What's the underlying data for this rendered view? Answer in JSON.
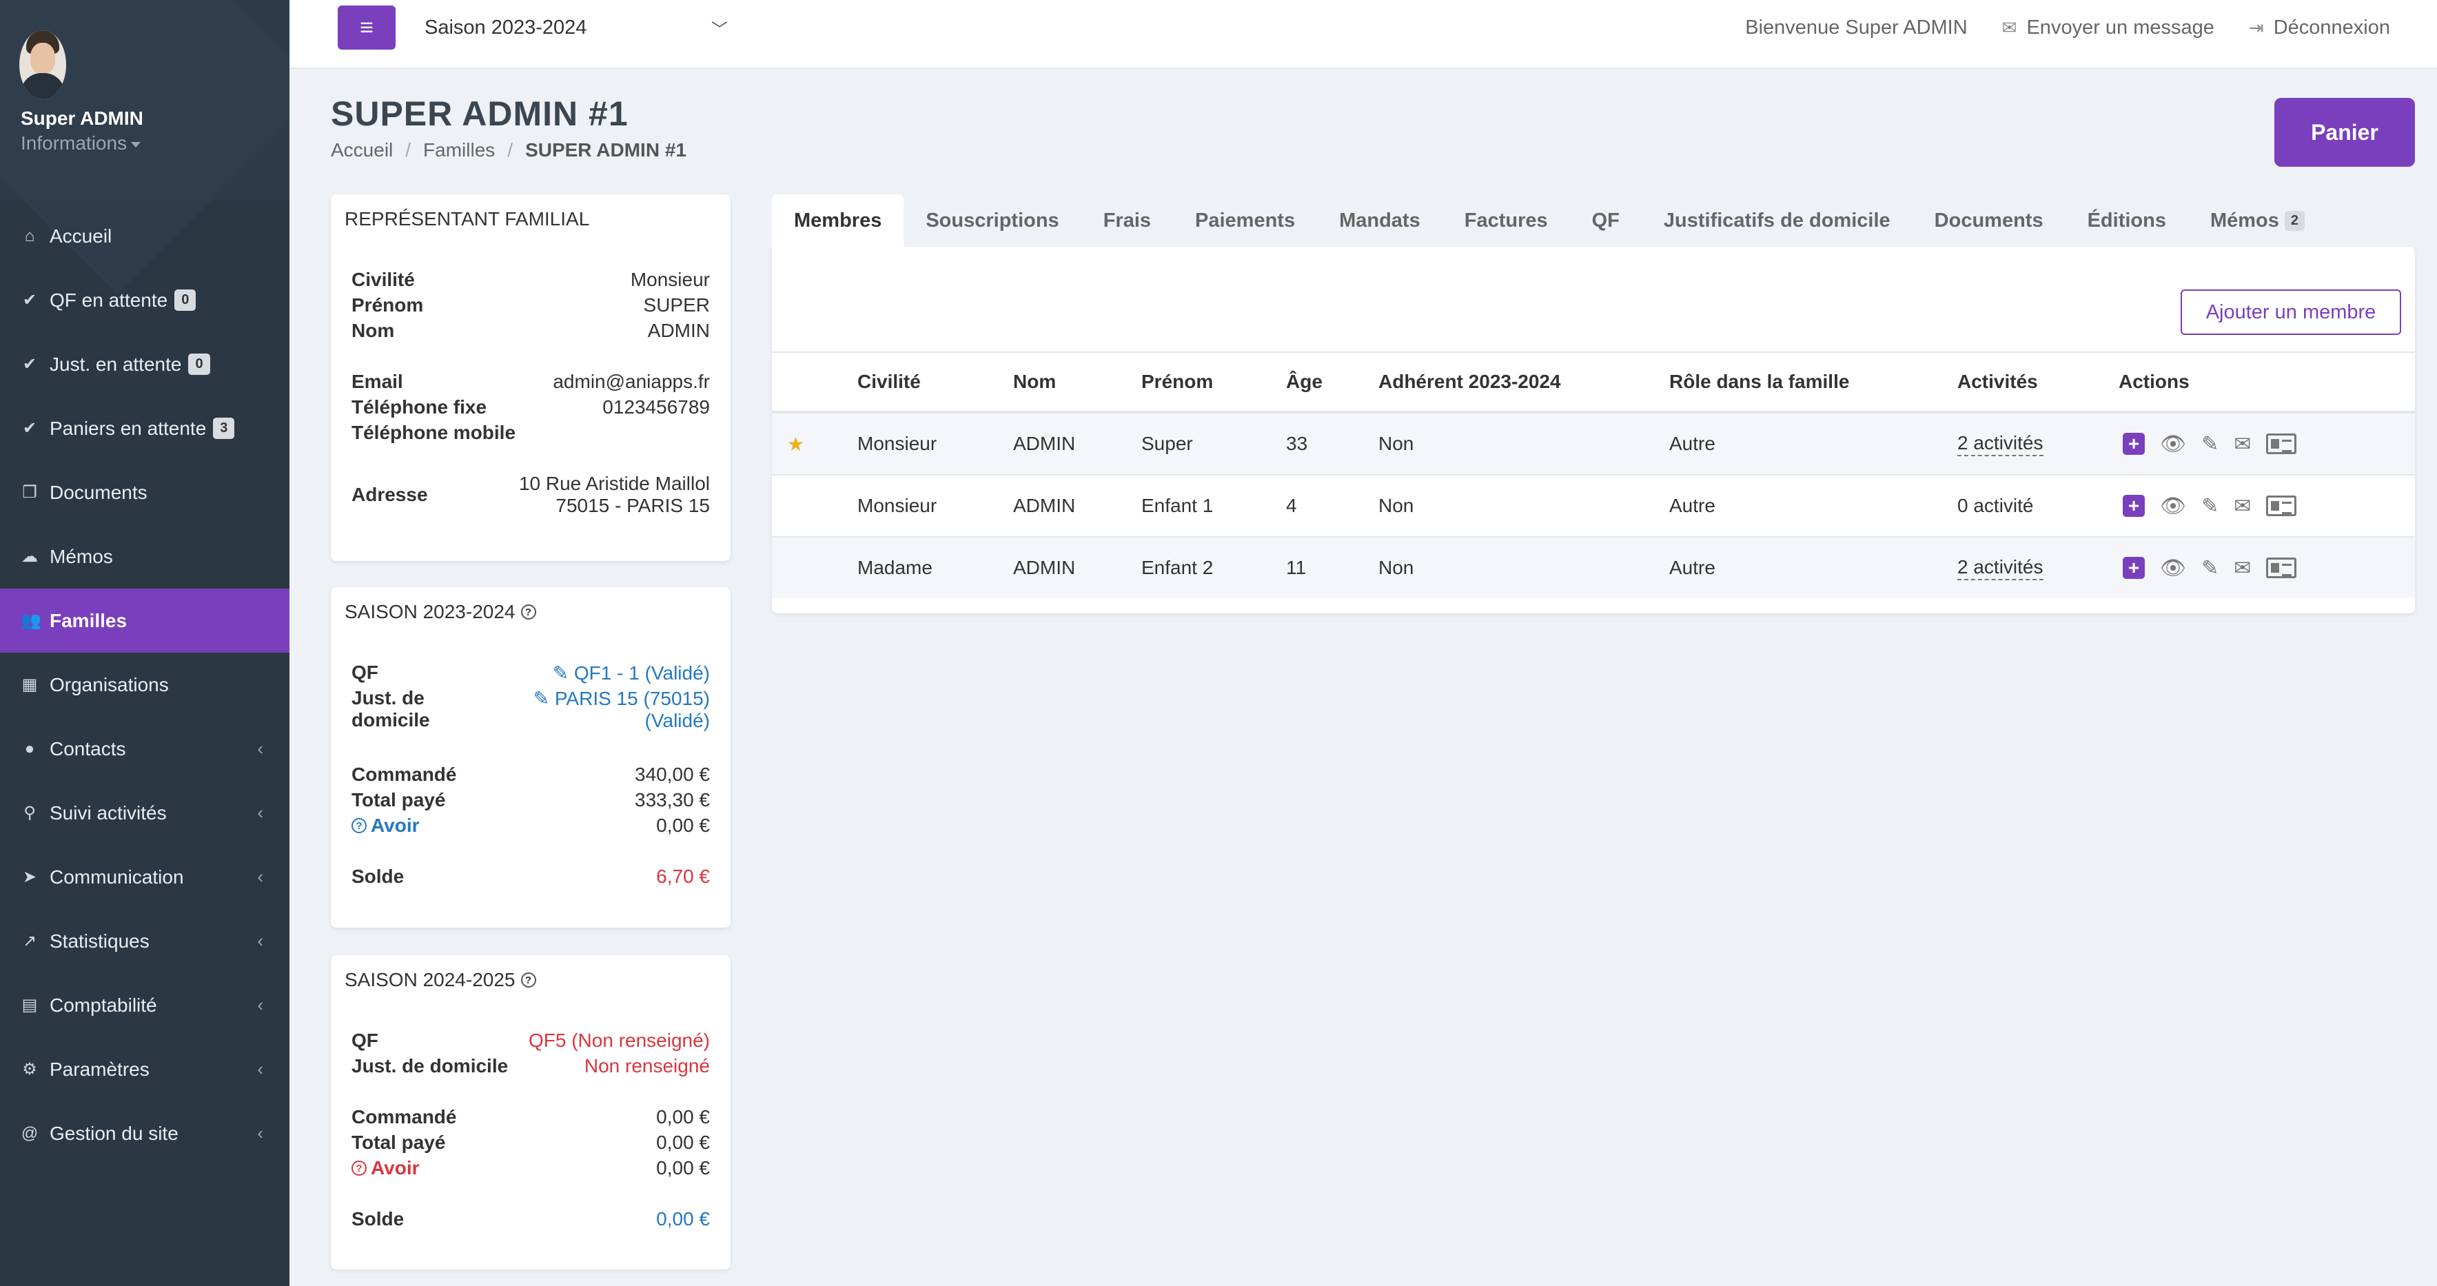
{
  "sidebar": {
    "profile": {
      "name": "Super ADMIN",
      "info_label": "Informations"
    },
    "items": [
      {
        "label": "Accueil",
        "icon": "home-icon",
        "glyph": "⌂"
      },
      {
        "label": "QF en attente",
        "icon": "check-icon",
        "glyph": "✔",
        "badge": "0"
      },
      {
        "label": "Just. en attente",
        "icon": "check-icon",
        "glyph": "✔",
        "badge": "0"
      },
      {
        "label": "Paniers en attente",
        "icon": "check-icon",
        "glyph": "✔",
        "badge": "3"
      },
      {
        "label": "Documents",
        "icon": "copy-icon",
        "glyph": "❐"
      },
      {
        "label": "Mémos",
        "icon": "comments-icon",
        "glyph": "☁"
      },
      {
        "label": "Familles",
        "icon": "users-icon",
        "glyph": "👥"
      },
      {
        "label": "Organisations",
        "icon": "building-icon",
        "glyph": "▦"
      },
      {
        "label": "Contacts",
        "icon": "user-icon",
        "glyph": "●"
      },
      {
        "label": "Suivi activités",
        "icon": "bicycle-icon",
        "glyph": "⚲"
      },
      {
        "label": "Communication",
        "icon": "send-icon",
        "glyph": "➤"
      },
      {
        "label": "Statistiques",
        "icon": "chart-icon",
        "glyph": "↗"
      },
      {
        "label": "Comptabilité",
        "icon": "calculator-icon",
        "glyph": "▤"
      },
      {
        "label": "Paramètres",
        "icon": "gears-icon",
        "glyph": "⚙"
      },
      {
        "label": "Gestion du site",
        "icon": "at-icon",
        "glyph": "@"
      }
    ]
  },
  "topbar": {
    "season": "Saison 2023-2024",
    "welcome": "Bienvenue Super ADMIN",
    "message": "Envoyer un message",
    "logout": "Déconnexion"
  },
  "page": {
    "title": "SUPER ADMIN #1",
    "breadcrumb": [
      "Accueil",
      "Familles",
      "SUPER ADMIN #1"
    ],
    "cart_button": "Panier"
  },
  "representative": {
    "title": "REPRÉSENTANT FAMILIAL",
    "civilite_k": "Civilité",
    "civilite_v": "Monsieur",
    "prenom_k": "Prénom",
    "prenom_v": "SUPER",
    "nom_k": "Nom",
    "nom_v": "ADMIN",
    "email_k": "Email",
    "email_v": "admin@aniapps.fr",
    "tel_fixe_k": "Téléphone fixe",
    "tel_fixe_v": "0123456789",
    "tel_mobile_k": "Téléphone mobile",
    "adresse_k": "Adresse",
    "adresse_l1": "10 Rue Aristide Maillol",
    "adresse_l2": "75015 - PARIS 15"
  },
  "season1": {
    "title": "SAISON 2023-2024",
    "qf_k": "QF",
    "qf_v": "QF1 - 1 (Validé)",
    "just_k1": "Just. de",
    "just_k2": "domicile",
    "just_v1": "PARIS 15 (75015)",
    "just_v2": "(Validé)",
    "commande_k": "Commandé",
    "commande_v": "340,00 €",
    "paye_k": "Total payé",
    "paye_v": "333,30 €",
    "avoir_k": "Avoir",
    "avoir_v": "0,00 €",
    "solde_k": "Solde",
    "solde_v": "6,70 €"
  },
  "season2": {
    "title": "SAISON 2024-2025",
    "qf_k": "QF",
    "qf_v": "QF5 (Non renseigné)",
    "just_k": "Just. de domicile",
    "just_v": "Non renseigné",
    "commande_k": "Commandé",
    "commande_v": "0,00 €",
    "paye_k": "Total payé",
    "paye_v": "0,00 €",
    "avoir_k": "Avoir",
    "avoir_v": "0,00 €",
    "solde_k": "Solde",
    "solde_v": "0,00 €"
  },
  "tabs": [
    {
      "label": "Membres"
    },
    {
      "label": "Souscriptions"
    },
    {
      "label": "Frais"
    },
    {
      "label": "Paiements"
    },
    {
      "label": "Mandats"
    },
    {
      "label": "Factures"
    },
    {
      "label": "QF"
    },
    {
      "label": "Justificatifs de domicile"
    },
    {
      "label": "Documents"
    },
    {
      "label": "Éditions"
    },
    {
      "label": "Mémos",
      "count": "2"
    }
  ],
  "members": {
    "add_button": "Ajouter un membre",
    "headers": [
      "Civilité",
      "Nom",
      "Prénom",
      "Âge",
      "Adhérent 2023-2024",
      "Rôle dans la famille",
      "Activités",
      "Actions"
    ],
    "rows": [
      {
        "civilite": "Monsieur",
        "nom": "ADMIN",
        "prenom": "Super",
        "age": "33",
        "adherent": "Non",
        "role": "Autre",
        "activites": "2 activités"
      },
      {
        "civilite": "Monsieur",
        "nom": "ADMIN",
        "prenom": "Enfant 1",
        "age": "4",
        "adherent": "Non",
        "role": "Autre",
        "activites": "0 activité"
      },
      {
        "civilite": "Madame",
        "nom": "ADMIN",
        "prenom": "Enfant 2",
        "age": "11",
        "adherent": "Non",
        "role": "Autre",
        "activites": "2 activités"
      }
    ]
  },
  "colors": {
    "accent": "#7a3fbd",
    "sidebar": "#2c3744",
    "link": "#2478c2",
    "danger": "#d9363e"
  }
}
